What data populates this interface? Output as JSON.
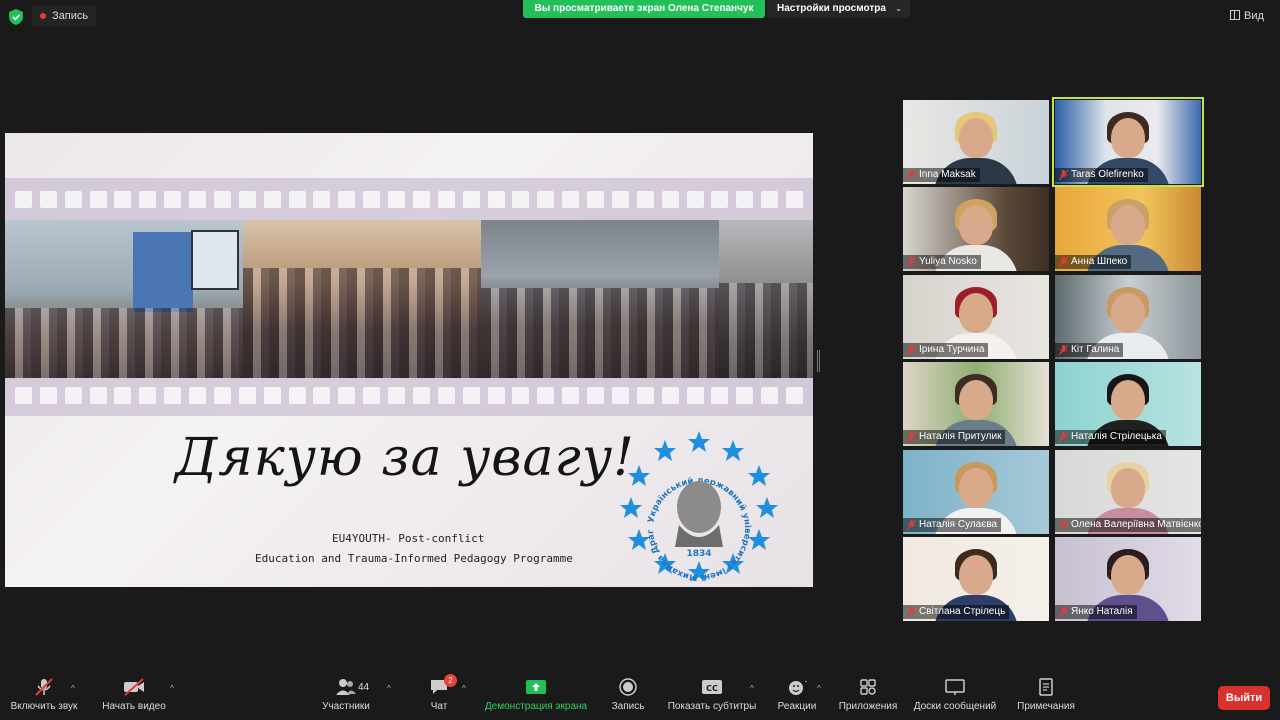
{
  "top_bar": {
    "recording_label": "Запись",
    "share_banner": "Вы просматриваете экран Олена Степанчук",
    "view_options": "Настройки просмотра",
    "view_button": "Вид"
  },
  "slide": {
    "thanks": "Дякую за увагу!",
    "subtitle_line1": "EU4YOUTH- Post-conflict",
    "subtitle_line2": "Education and Trauma-Informed Pedagogy Programme",
    "logo_ring_text": "Український державний університет імені Михайла Драгоманова",
    "logo_year": "1834"
  },
  "participants": [
    {
      "name": "Inna Maksak",
      "active": false
    },
    {
      "name": "Taras Olefirenko",
      "active": true
    },
    {
      "name": "Yuliya Nosko",
      "active": false
    },
    {
      "name": "Анна Шпеко",
      "active": false
    },
    {
      "name": "Ірина Турчина",
      "active": false
    },
    {
      "name": "Кіт Галина",
      "active": false
    },
    {
      "name": "Наталія Притулик",
      "active": false
    },
    {
      "name": "Наталія Стрілецька",
      "active": false
    },
    {
      "name": "Наталія Сулаєва",
      "active": false
    },
    {
      "name": "Олена Валеріївна Матвієнко",
      "active": false
    },
    {
      "name": "Світлана Стрілець",
      "active": false
    },
    {
      "name": "Янко Наталія",
      "active": false
    }
  ],
  "toolbar": {
    "unmute": "Включить звук",
    "start_video": "Начать видео",
    "participants": "Участники",
    "participants_count": "44",
    "chat": "Чат",
    "chat_badge": "2",
    "share_screen": "Демонстрация экрана",
    "record": "Запись",
    "captions": "Показать субтитры",
    "reactions": "Реакции",
    "apps": "Приложения",
    "whiteboards": "Доски сообщений",
    "notes": "Примечания",
    "leave": "Выйти"
  },
  "colors": {
    "share_green": "#23c05a",
    "active_speaker": "#c6e24a",
    "leave_red": "#d9312d",
    "star_blue": "#1f8fe0"
  }
}
